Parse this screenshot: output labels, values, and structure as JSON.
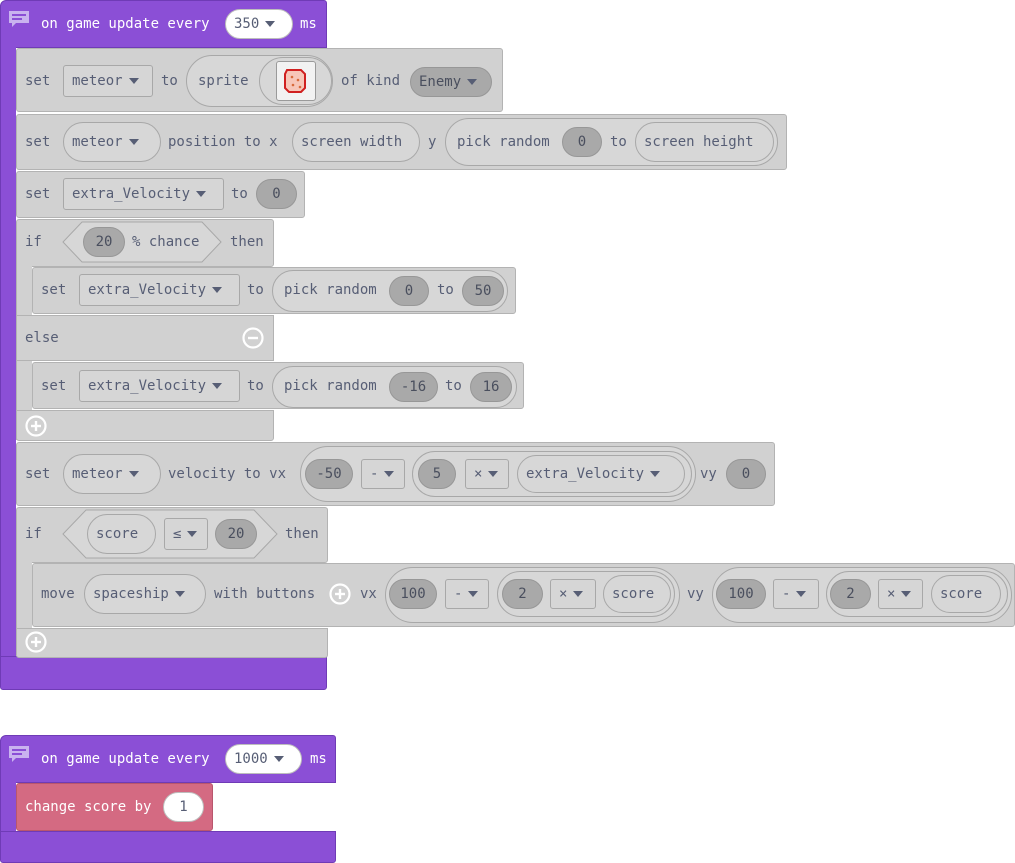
{
  "ev1": {
    "label": "on game update every",
    "interval": "350",
    "unit": "ms"
  },
  "b1": {
    "set": "set",
    "var": "meteor",
    "to": "to",
    "sprite": "sprite",
    "of_kind": "of kind",
    "kind": "Enemy"
  },
  "b2": {
    "set": "set",
    "var": "meteor",
    "position_to_x": "position to x",
    "x_value": "screen width",
    "y": "y",
    "pick_random": "pick random",
    "min": "0",
    "to": "to",
    "max": "screen height"
  },
  "b3": {
    "set": "set",
    "var": "extra_Velocity",
    "to": "to",
    "value": "0"
  },
  "if1": {
    "if": "if",
    "chance": "20",
    "chance_label": "% chance",
    "then": "then"
  },
  "b4": {
    "set": "set",
    "var": "extra_Velocity",
    "to": "to",
    "pick_random": "pick random",
    "min": "0",
    "to2": "to",
    "max": "50"
  },
  "else": {
    "label": "else"
  },
  "b5": {
    "set": "set",
    "var": "extra_Velocity",
    "to": "to",
    "pick_random": "pick random",
    "min": "-16",
    "to2": "to",
    "max": "16"
  },
  "b6": {
    "set": "set",
    "var": "meteor",
    "velocity_to_vx": "velocity to vx",
    "a": "-50",
    "op1": "-",
    "b": "5",
    "op2": "×",
    "c": "extra_Velocity",
    "vy": "vy",
    "vy_value": "0"
  },
  "if2": {
    "if": "if",
    "left": "score",
    "op": "≤",
    "right": "20",
    "then": "then"
  },
  "b7": {
    "move": "move",
    "sprite": "spaceship",
    "with_buttons": "with buttons",
    "vx": "vx",
    "vx_a": "100",
    "vx_op": "-",
    "vx_b": "2",
    "vx_op2": "×",
    "vx_c": "score",
    "vy": "vy",
    "vy_a": "100",
    "vy_op": "-",
    "vy_b": "2",
    "vy_op2": "×",
    "vy_c": "score"
  },
  "ev2": {
    "label": "on game update every",
    "interval": "1000",
    "unit": "ms"
  },
  "b8": {
    "change": "change score by",
    "value": "1"
  },
  "colors": {
    "event": "#8b4fd6",
    "block": "#d1d1d1",
    "info": "#d46a82"
  },
  "icons": {
    "comment": "comment-icon",
    "dropdown": "chevron-down-icon",
    "add": "plus-circle-icon",
    "remove": "minus-circle-icon",
    "sprite": "sprite-thumbnail-icon"
  }
}
